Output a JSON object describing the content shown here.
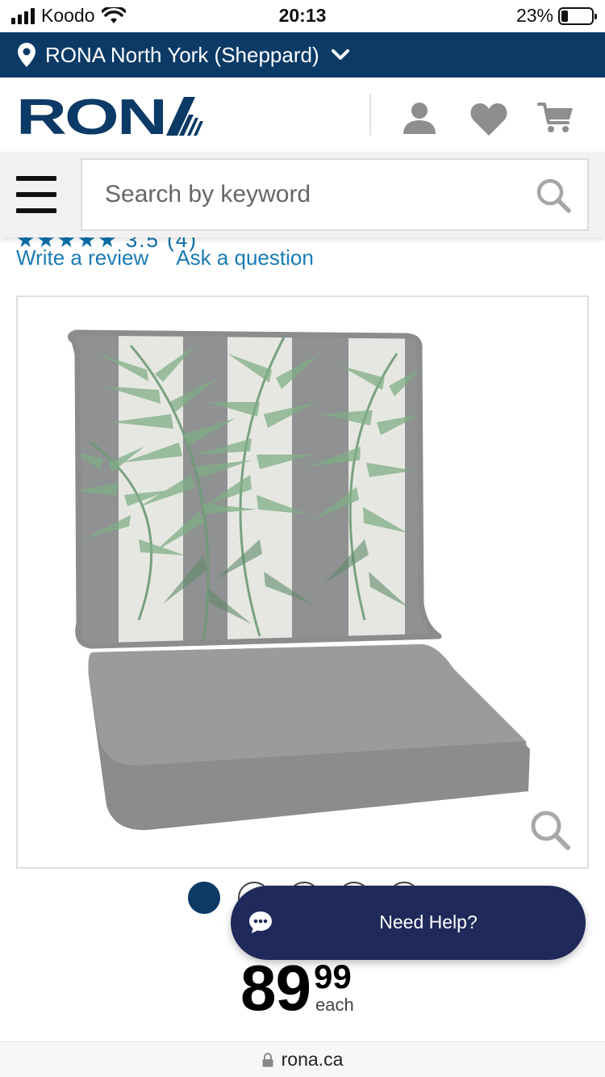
{
  "status_bar": {
    "carrier": "Koodo",
    "time": "20:13",
    "battery": "23%",
    "battery_level": 0.23
  },
  "store_bar": {
    "store_name": "RONA North York (Sheppard)"
  },
  "header": {
    "logo_text": "RONA",
    "icons": [
      "account-icon",
      "heart-icon",
      "cart-icon"
    ]
  },
  "search": {
    "placeholder": "Search by keyword"
  },
  "reviews": {
    "rating_partial": "★★★★★   3.5  (4)",
    "write_review": "Write a review",
    "ask_question": "Ask a question"
  },
  "product_image": {
    "alt": "Patio seat cushion with palm leaf back pillow"
  },
  "carousel": {
    "count": 5,
    "active_index": 0
  },
  "help": {
    "label": "Need Help?"
  },
  "price": {
    "dollars": "89",
    "cents": "99",
    "unit": "each"
  },
  "url_bar": {
    "domain": "rona.ca"
  },
  "colors": {
    "brand_navy": "#0b3a66",
    "link_blue": "#1a7bb5",
    "help_navy": "#1f2a5a"
  }
}
